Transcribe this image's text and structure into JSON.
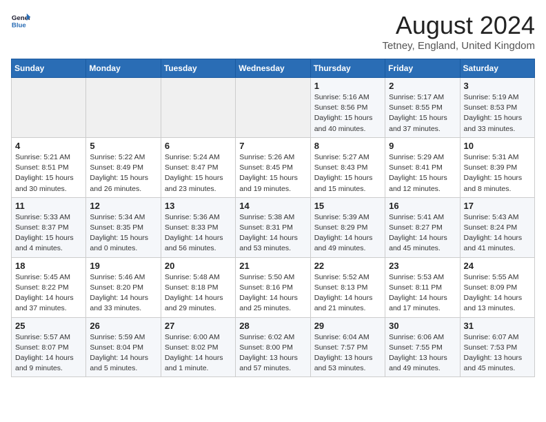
{
  "header": {
    "logo_general": "General",
    "logo_blue": "Blue",
    "month_year": "August 2024",
    "location": "Tetney, England, United Kingdom"
  },
  "weekdays": [
    "Sunday",
    "Monday",
    "Tuesday",
    "Wednesday",
    "Thursday",
    "Friday",
    "Saturday"
  ],
  "weeks": [
    [
      {
        "day": "",
        "sunrise": "",
        "sunset": "",
        "daylight": ""
      },
      {
        "day": "",
        "sunrise": "",
        "sunset": "",
        "daylight": ""
      },
      {
        "day": "",
        "sunrise": "",
        "sunset": "",
        "daylight": ""
      },
      {
        "day": "",
        "sunrise": "",
        "sunset": "",
        "daylight": ""
      },
      {
        "day": "1",
        "sunrise": "Sunrise: 5:16 AM",
        "sunset": "Sunset: 8:56 PM",
        "daylight": "Daylight: 15 hours and 40 minutes."
      },
      {
        "day": "2",
        "sunrise": "Sunrise: 5:17 AM",
        "sunset": "Sunset: 8:55 PM",
        "daylight": "Daylight: 15 hours and 37 minutes."
      },
      {
        "day": "3",
        "sunrise": "Sunrise: 5:19 AM",
        "sunset": "Sunset: 8:53 PM",
        "daylight": "Daylight: 15 hours and 33 minutes."
      }
    ],
    [
      {
        "day": "4",
        "sunrise": "Sunrise: 5:21 AM",
        "sunset": "Sunset: 8:51 PM",
        "daylight": "Daylight: 15 hours and 30 minutes."
      },
      {
        "day": "5",
        "sunrise": "Sunrise: 5:22 AM",
        "sunset": "Sunset: 8:49 PM",
        "daylight": "Daylight: 15 hours and 26 minutes."
      },
      {
        "day": "6",
        "sunrise": "Sunrise: 5:24 AM",
        "sunset": "Sunset: 8:47 PM",
        "daylight": "Daylight: 15 hours and 23 minutes."
      },
      {
        "day": "7",
        "sunrise": "Sunrise: 5:26 AM",
        "sunset": "Sunset: 8:45 PM",
        "daylight": "Daylight: 15 hours and 19 minutes."
      },
      {
        "day": "8",
        "sunrise": "Sunrise: 5:27 AM",
        "sunset": "Sunset: 8:43 PM",
        "daylight": "Daylight: 15 hours and 15 minutes."
      },
      {
        "day": "9",
        "sunrise": "Sunrise: 5:29 AM",
        "sunset": "Sunset: 8:41 PM",
        "daylight": "Daylight: 15 hours and 12 minutes."
      },
      {
        "day": "10",
        "sunrise": "Sunrise: 5:31 AM",
        "sunset": "Sunset: 8:39 PM",
        "daylight": "Daylight: 15 hours and 8 minutes."
      }
    ],
    [
      {
        "day": "11",
        "sunrise": "Sunrise: 5:33 AM",
        "sunset": "Sunset: 8:37 PM",
        "daylight": "Daylight: 15 hours and 4 minutes."
      },
      {
        "day": "12",
        "sunrise": "Sunrise: 5:34 AM",
        "sunset": "Sunset: 8:35 PM",
        "daylight": "Daylight: 15 hours and 0 minutes."
      },
      {
        "day": "13",
        "sunrise": "Sunrise: 5:36 AM",
        "sunset": "Sunset: 8:33 PM",
        "daylight": "Daylight: 14 hours and 56 minutes."
      },
      {
        "day": "14",
        "sunrise": "Sunrise: 5:38 AM",
        "sunset": "Sunset: 8:31 PM",
        "daylight": "Daylight: 14 hours and 53 minutes."
      },
      {
        "day": "15",
        "sunrise": "Sunrise: 5:39 AM",
        "sunset": "Sunset: 8:29 PM",
        "daylight": "Daylight: 14 hours and 49 minutes."
      },
      {
        "day": "16",
        "sunrise": "Sunrise: 5:41 AM",
        "sunset": "Sunset: 8:27 PM",
        "daylight": "Daylight: 14 hours and 45 minutes."
      },
      {
        "day": "17",
        "sunrise": "Sunrise: 5:43 AM",
        "sunset": "Sunset: 8:24 PM",
        "daylight": "Daylight: 14 hours and 41 minutes."
      }
    ],
    [
      {
        "day": "18",
        "sunrise": "Sunrise: 5:45 AM",
        "sunset": "Sunset: 8:22 PM",
        "daylight": "Daylight: 14 hours and 37 minutes."
      },
      {
        "day": "19",
        "sunrise": "Sunrise: 5:46 AM",
        "sunset": "Sunset: 8:20 PM",
        "daylight": "Daylight: 14 hours and 33 minutes."
      },
      {
        "day": "20",
        "sunrise": "Sunrise: 5:48 AM",
        "sunset": "Sunset: 8:18 PM",
        "daylight": "Daylight: 14 hours and 29 minutes."
      },
      {
        "day": "21",
        "sunrise": "Sunrise: 5:50 AM",
        "sunset": "Sunset: 8:16 PM",
        "daylight": "Daylight: 14 hours and 25 minutes."
      },
      {
        "day": "22",
        "sunrise": "Sunrise: 5:52 AM",
        "sunset": "Sunset: 8:13 PM",
        "daylight": "Daylight: 14 hours and 21 minutes."
      },
      {
        "day": "23",
        "sunrise": "Sunrise: 5:53 AM",
        "sunset": "Sunset: 8:11 PM",
        "daylight": "Daylight: 14 hours and 17 minutes."
      },
      {
        "day": "24",
        "sunrise": "Sunrise: 5:55 AM",
        "sunset": "Sunset: 8:09 PM",
        "daylight": "Daylight: 14 hours and 13 minutes."
      }
    ],
    [
      {
        "day": "25",
        "sunrise": "Sunrise: 5:57 AM",
        "sunset": "Sunset: 8:07 PM",
        "daylight": "Daylight: 14 hours and 9 minutes."
      },
      {
        "day": "26",
        "sunrise": "Sunrise: 5:59 AM",
        "sunset": "Sunset: 8:04 PM",
        "daylight": "Daylight: 14 hours and 5 minutes."
      },
      {
        "day": "27",
        "sunrise": "Sunrise: 6:00 AM",
        "sunset": "Sunset: 8:02 PM",
        "daylight": "Daylight: 14 hours and 1 minute."
      },
      {
        "day": "28",
        "sunrise": "Sunrise: 6:02 AM",
        "sunset": "Sunset: 8:00 PM",
        "daylight": "Daylight: 13 hours and 57 minutes."
      },
      {
        "day": "29",
        "sunrise": "Sunrise: 6:04 AM",
        "sunset": "Sunset: 7:57 PM",
        "daylight": "Daylight: 13 hours and 53 minutes."
      },
      {
        "day": "30",
        "sunrise": "Sunrise: 6:06 AM",
        "sunset": "Sunset: 7:55 PM",
        "daylight": "Daylight: 13 hours and 49 minutes."
      },
      {
        "day": "31",
        "sunrise": "Sunrise: 6:07 AM",
        "sunset": "Sunset: 7:53 PM",
        "daylight": "Daylight: 13 hours and 45 minutes."
      }
    ]
  ]
}
